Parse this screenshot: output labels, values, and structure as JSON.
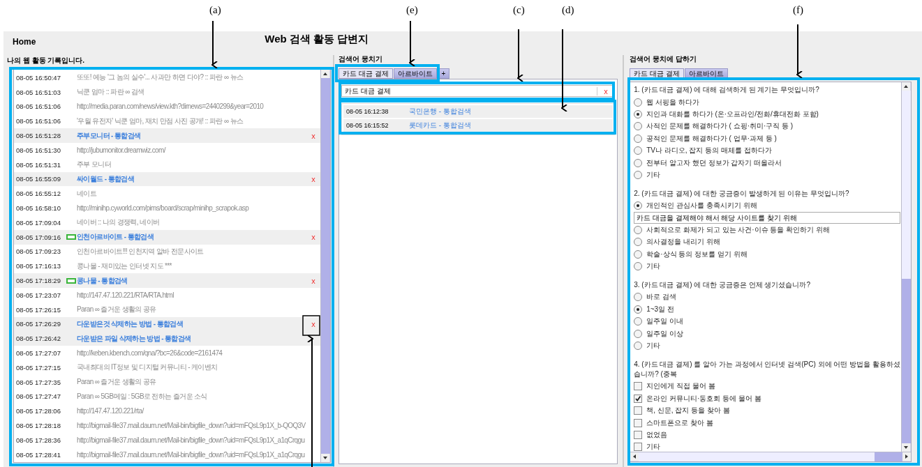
{
  "annotations": [
    {
      "label": "(a)"
    },
    {
      "label": "(e)"
    },
    {
      "label": "(c)"
    },
    {
      "label": "(d)"
    },
    {
      "label": "(f)"
    }
  ],
  "header": {
    "home": "Home",
    "title": "Web 검색 활동 답변지"
  },
  "history": {
    "title": "나의 웹 활동 기록입니다.",
    "rows": [
      {
        "time": "08-05 16:50:47",
        "text": "또또! 예능 '그 놈의 실수'... 사과만 하면 다야? :: 파란 ∞ 뉴스",
        "kind": "page"
      },
      {
        "time": "08-05 16:51:03",
        "text": "닉쿤 엄마 :: 파란 ∞ 검색",
        "kind": "page"
      },
      {
        "time": "08-05 16:51:06",
        "text": "http://media.paran.com/news/view.kth?dirnews=2440299&year=2010",
        "kind": "page"
      },
      {
        "time": "08-05 16:51:06",
        "text": "'우월 유전자' 닉쿤 엄마, 재치 만점 사진 공개! :: 파란 ∞ 뉴스",
        "kind": "page"
      },
      {
        "time": "08-05 16:51:28",
        "text": "주부모니터 - 통합검색",
        "kind": "search",
        "tagged": false,
        "remove": "x"
      },
      {
        "time": "08-05 16:51:30",
        "text": "http://jubumonitor.dreamwiz.com/",
        "kind": "page"
      },
      {
        "time": "08-05 16:51:31",
        "text": "주부 모니터",
        "kind": "page"
      },
      {
        "time": "08-05 16:55:09",
        "text": "싸이월드 - 통합검색",
        "kind": "search",
        "tagged": false,
        "remove": "x"
      },
      {
        "time": "08-05 16:55:12",
        "text": "네이트",
        "kind": "page"
      },
      {
        "time": "08-05 16:58:10",
        "text": "http://minihp.cyworld.com/pims/board/scrap/minihp_scrapok.asp",
        "kind": "page"
      },
      {
        "time": "08-05 17:09:04",
        "text": "네이버 :: 나의 경쟁력, 네이버",
        "kind": "page"
      },
      {
        "time": "08-05 17:09:16",
        "text": "인천아르바이트 - 통합검색",
        "kind": "search",
        "tagged": true,
        "remove": "x"
      },
      {
        "time": "08-05 17:09:23",
        "text": "인천아르바이트!!! 인천지역 알바 전문사이트",
        "kind": "page"
      },
      {
        "time": "08-05 17:16:13",
        "text": "콩나물 - 재미있는 인터넷 지도 ***",
        "kind": "page"
      },
      {
        "time": "08-05 17:18:29",
        "text": "콩나물 - 통합검색",
        "kind": "search",
        "tagged": true,
        "remove": "x"
      },
      {
        "time": "08-05 17:23:07",
        "text": "http://147.47.120.221/RTA/RTA.html",
        "kind": "page"
      },
      {
        "time": "08-05 17:26:15",
        "text": "Paran ∞ 즐거운 생활의 공유",
        "kind": "page"
      },
      {
        "time": "08-05 17:26:29",
        "text": "다운받은것 삭제하는 방법 - 통합검색",
        "kind": "search",
        "tagged": false,
        "remove": "x"
      },
      {
        "time": "08-05 17:26:42",
        "text": "다운받은 파일 삭제하는 방법 - 통합검색",
        "kind": "search",
        "tagged": false
      },
      {
        "time": "08-05 17:27:07",
        "text": "http://keben.kbench.com/qna/?bc=26&code=2161474",
        "kind": "page"
      },
      {
        "time": "08-05 17:27:15",
        "text": "국내최대의 IT정보 및 디지털 커뮤니티 - 케이벤치",
        "kind": "page"
      },
      {
        "time": "08-05 17:27:35",
        "text": "Paran ∞ 즐거운 생활의 공유",
        "kind": "page"
      },
      {
        "time": "08-05 17:27:47",
        "text": "Paran ∞ 5GB메일 : 5GB로 전하는 즐거운 소식",
        "kind": "page"
      },
      {
        "time": "08-05 17:28:06",
        "text": "http://147.47.120.221/rta/",
        "kind": "page"
      },
      {
        "time": "08-05 17:28:18",
        "text": "http://bigmail-file37.mail.daum.net/Mail-bin/bigfile_down?uid=mFQsL9p1X_b-QOQ3V",
        "kind": "page"
      },
      {
        "time": "08-05 17:28:36",
        "text": "http://bigmail-file37.mail.daum.net/Mail-bin/bigfile_down?uid=mFQsL9p1X_a1qCrqgu",
        "kind": "page"
      },
      {
        "time": "08-05 17:28:41",
        "text": "http://bigmail-file37.mail.daum.net/Mail-bin/bigfile_down?uid=mFQsL9p1X_a1qCrqgu",
        "kind": "page"
      }
    ]
  },
  "bundles": {
    "title": "검색어 뭉치기",
    "tabs": [
      {
        "label": "카드 대금 결제",
        "selected": true
      },
      {
        "label": "아르바이트",
        "selected": false
      },
      {
        "label": "+",
        "selected": false
      }
    ],
    "field": {
      "value": "카드 대금 결제",
      "clear": "x"
    },
    "results": [
      {
        "time": "08-05 16:12:38",
        "text": "국민은행 - 통합검색"
      },
      {
        "time": "08-05 16:15:52",
        "text": "롯데카드 - 통합검색"
      }
    ]
  },
  "answers": {
    "title": "검색어 뭉치에 답하기",
    "tabs": [
      {
        "label": "카드 대금 결제",
        "selected": true
      },
      {
        "label": "아르바이트",
        "selected": false
      }
    ],
    "questions": [
      {
        "text": "1. (카드 대금 결제) 에 대해 검색하게 된 계기는 무엇입니까?",
        "kind": "radio",
        "options": [
          {
            "label": "웹 서핑을 하다가",
            "selected": false
          },
          {
            "label": "지인과 대화를 하다가 (온·오프라인/전화/휴대전화 포함)",
            "selected": true
          },
          {
            "label": "사적인 문제를 해결하다가 ( 쇼핑·취미·구직 등 )",
            "selected": false
          },
          {
            "label": "공적인 문제를 해결하다가 ( 업무·과제 등 )",
            "selected": false
          },
          {
            "label": "TV나 라디오, 잡지 등의 매체를 접하다가",
            "selected": false
          },
          {
            "label": "전부터 알고자 했던 정보가 갑자기 떠올라서",
            "selected": false
          },
          {
            "label": "기타",
            "selected": false
          }
        ]
      },
      {
        "text": "2. (카드 대금 결제) 에 대한 궁금증이 발생하게 된 이유는 무엇입니까?",
        "kind": "radio",
        "options": [
          {
            "label": "개인적인 관심사를 충족시키기 위해",
            "selected": true,
            "answer": "카드 대금을 결제해야 해서 해당 사이트를 찾기 위해"
          },
          {
            "label": "사회적으로 화제가 되고 있는 사건·이슈 등을 확인하기 위해",
            "selected": false
          },
          {
            "label": "의사결정을 내리기 위해",
            "selected": false
          },
          {
            "label": "학술·상식 등의 정보를 얻기 위해",
            "selected": false
          },
          {
            "label": "기타",
            "selected": false
          }
        ]
      },
      {
        "text": "3. (카드 대금 결제) 에 대한 궁금증은 언제 생기셨습니까?",
        "kind": "radio",
        "options": [
          {
            "label": "바로 검색",
            "selected": false
          },
          {
            "label": "1~3일 전",
            "selected": true
          },
          {
            "label": "일주일 이내",
            "selected": false
          },
          {
            "label": "일주일 이상",
            "selected": false
          },
          {
            "label": "기타",
            "selected": false
          }
        ]
      },
      {
        "text": "4. (카드 대금 결제) 를 알아 가는 과정에서 인터넷 검색(PC) 외에 어떤 방법을 활용하셨습니까? (중복",
        "kind": "checkbox",
        "options": [
          {
            "label": "지인에게 직접 물어 봄",
            "checked": false
          },
          {
            "label": "온라인 커뮤니티·동호회 등에 물어 봄",
            "checked": true
          },
          {
            "label": "책, 신문, 잡지 등을 찾아 봄",
            "checked": false
          },
          {
            "label": "스마트폰으로 찾아 봄",
            "checked": false
          },
          {
            "label": "없었음",
            "checked": false
          },
          {
            "label": "기타",
            "checked": false
          }
        ]
      }
    ]
  }
}
